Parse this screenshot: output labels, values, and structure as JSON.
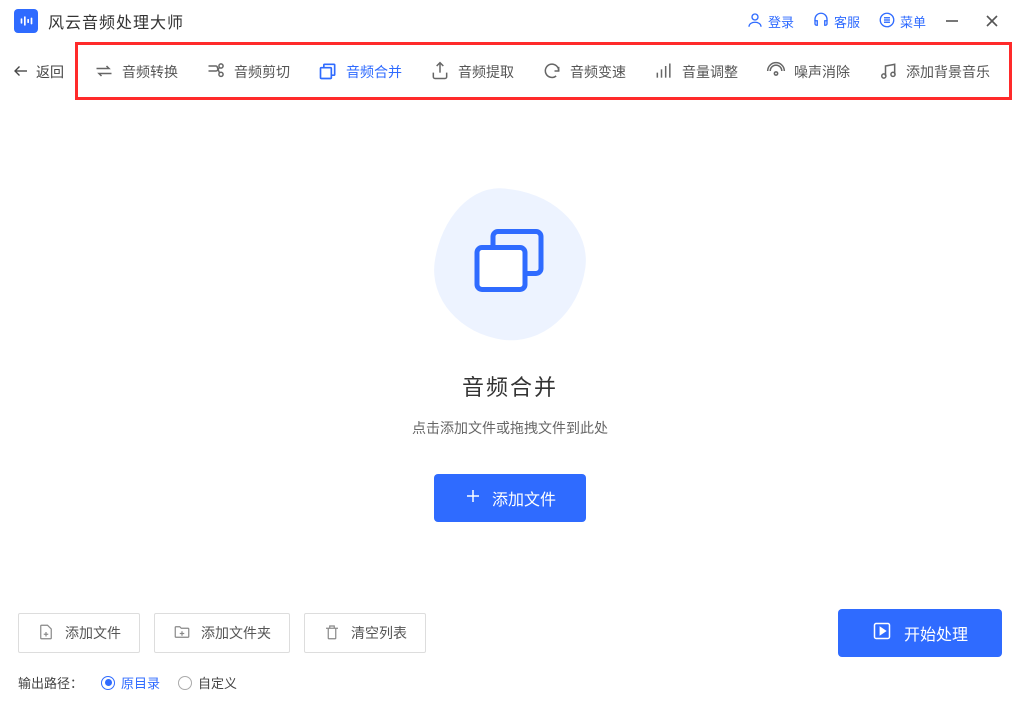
{
  "app": {
    "title": "风云音频处理大师"
  },
  "titlebar": {
    "login": "登录",
    "support": "客服",
    "menu": "菜单"
  },
  "back": {
    "label": "返回"
  },
  "toolbar": {
    "items": [
      {
        "label": "音频转换",
        "icon": "convert"
      },
      {
        "label": "音频剪切",
        "icon": "cut"
      },
      {
        "label": "音频合并",
        "icon": "merge",
        "active": true
      },
      {
        "label": "音频提取",
        "icon": "extract"
      },
      {
        "label": "音频变速",
        "icon": "speed"
      },
      {
        "label": "音量调整",
        "icon": "volume"
      },
      {
        "label": "噪声消除",
        "icon": "noise"
      },
      {
        "label": "添加背景音乐",
        "icon": "bgm"
      }
    ]
  },
  "hero": {
    "title": "音频合并",
    "subtitle": "点击添加文件或拖拽文件到此处",
    "add_label": "添加文件"
  },
  "bottom": {
    "add_file": "添加文件",
    "add_folder": "添加文件夹",
    "clear_list": "清空列表",
    "process": "开始处理"
  },
  "output": {
    "label": "输出路径：",
    "opt_original": "原目录",
    "opt_custom": "自定义",
    "selected": "original"
  }
}
